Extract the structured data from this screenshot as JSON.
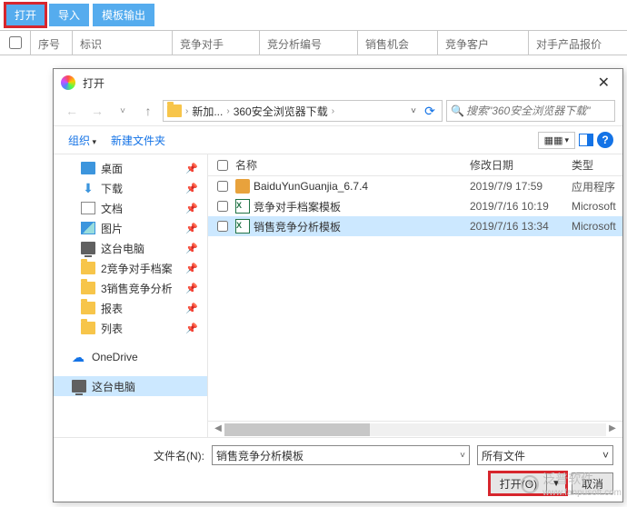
{
  "toolbar": {
    "open": "打开",
    "import": "导入",
    "template_output": "模板输出"
  },
  "table_headers": [
    "序号",
    "标识",
    "竞争对手",
    "竞分析编号",
    "销售机会",
    "竞争客户",
    "对手产品报价"
  ],
  "dialog": {
    "title": "打开",
    "path_parts": [
      "新加...",
      "360安全浏览器下载"
    ],
    "search_placeholder": "搜索\"360安全浏览器下载\"",
    "organize": "组织",
    "new_folder": "新建文件夹",
    "view_label": "▦▦",
    "columns": [
      "名称",
      "修改日期",
      "类型"
    ],
    "sidebar": [
      {
        "label": "桌面",
        "icon": "desk",
        "pin": true
      },
      {
        "label": "下载",
        "icon": "dl",
        "pin": true
      },
      {
        "label": "文档",
        "icon": "doc",
        "pin": true
      },
      {
        "label": "图片",
        "icon": "pic",
        "pin": true
      },
      {
        "label": "这台电脑",
        "icon": "pc",
        "pin": true
      },
      {
        "label": "2竞争对手档案",
        "icon": "folder",
        "pin": true
      },
      {
        "label": "3销售竞争分析",
        "icon": "folder",
        "pin": true
      },
      {
        "label": "报表",
        "icon": "folder",
        "pin": true
      },
      {
        "label": "列表",
        "icon": "folder",
        "pin": true
      },
      {
        "label": "OneDrive",
        "icon": "cloud",
        "pin": false,
        "top": true
      },
      {
        "label": "这台电脑",
        "icon": "pc",
        "pin": false,
        "top": true,
        "sel": true
      }
    ],
    "files": [
      {
        "name": "BaiduYunGuanjia_6.7.4",
        "date": "2019/7/9 17:59",
        "type": "应用程序",
        "icon": "exe"
      },
      {
        "name": "竞争对手档案模板",
        "date": "2019/7/16 10:19",
        "type": "Microsoft",
        "icon": "xls"
      },
      {
        "name": "销售竞争分析模板",
        "date": "2019/7/16 13:34",
        "type": "Microsoft",
        "icon": "xls",
        "sel": true
      }
    ],
    "filename_label": "文件名(N):",
    "filename_value": "销售竞争分析模板",
    "filter": "所有文件",
    "open_btn": "打开(O)",
    "cancel_btn": "取消"
  },
  "watermark": {
    "brand": "泛普软件",
    "url": "www.fanpusoft.com"
  }
}
